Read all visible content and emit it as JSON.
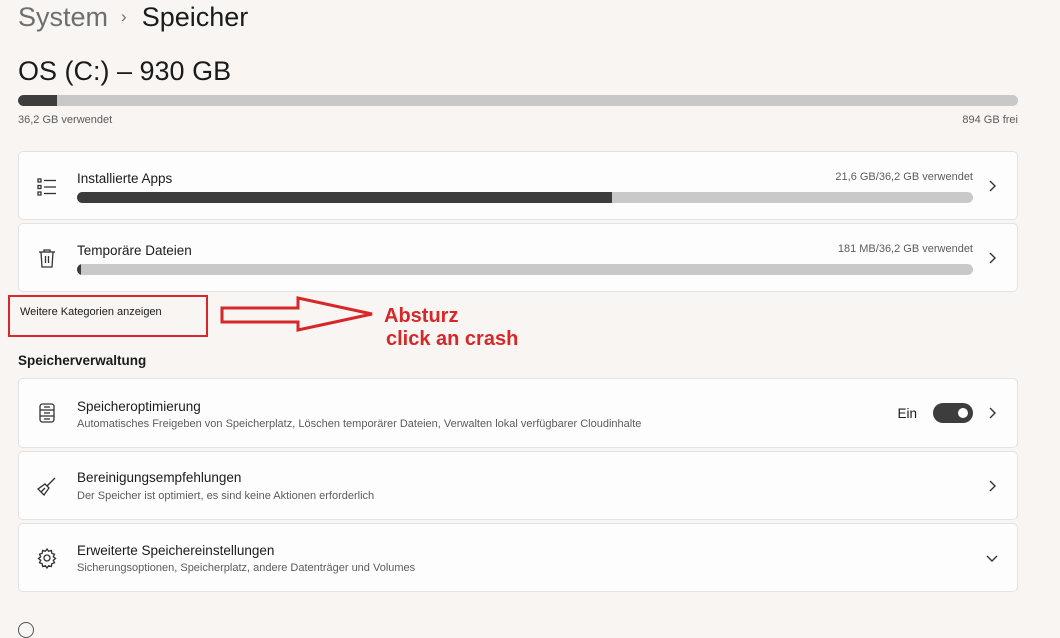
{
  "breadcrumb": {
    "parent": "System",
    "separator": "›",
    "current": "Speicher"
  },
  "drive": {
    "title": "OS (C:) – 930 GB",
    "used_label": "36,2 GB verwendet",
    "free_label": "894 GB frei",
    "used_fraction": 0.039
  },
  "categories": [
    {
      "title": "Installierte Apps",
      "usage": "21,6 GB/36,2 GB verwendet",
      "fraction": 0.597,
      "icon": "list-icon"
    },
    {
      "title": "Temporäre Dateien",
      "usage": "181 MB/36,2 GB verwendet",
      "fraction": 0.005,
      "icon": "trash-icon"
    }
  ],
  "more_categories": "Weitere Kategorien anzeigen",
  "annotation": {
    "line1": "Absturz",
    "line2": "click an crash",
    "color": "#d62828"
  },
  "management": {
    "heading": "Speicherverwaltung",
    "items": [
      {
        "title": "Speicheroptimierung",
        "desc": "Automatisches Freigeben von Speicherplatz, Löschen temporärer Dateien, Verwalten lokal verfügbarer Cloudinhalte",
        "toggle_label": "Ein",
        "toggle_on": true,
        "icon": "storage-drive-icon"
      },
      {
        "title": "Bereinigungsempfehlungen",
        "desc": "Der Speicher ist optimiert, es sind keine Aktionen erforderlich",
        "icon": "broom-icon"
      },
      {
        "title": "Erweiterte Speichereinstellungen",
        "desc": "Sicherungsoptionen, Speicherplatz, andere Datenträger und Volumes",
        "icon": "gear-icon"
      }
    ]
  }
}
